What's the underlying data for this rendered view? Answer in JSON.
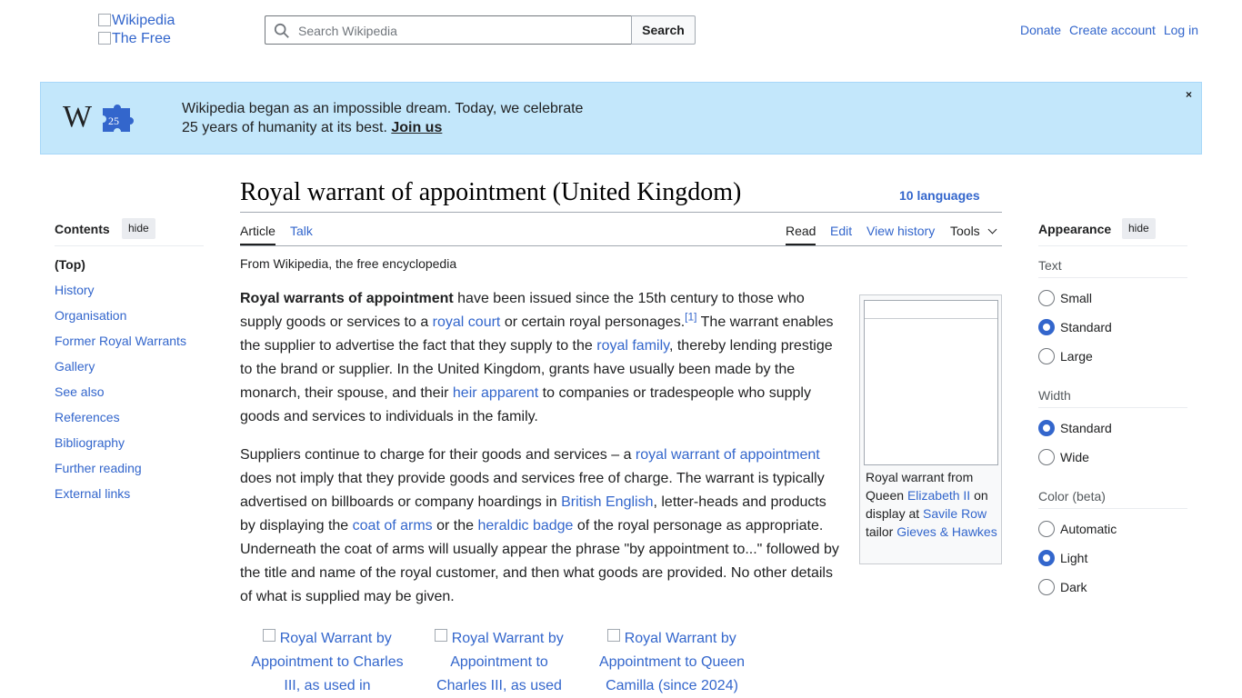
{
  "header": {
    "logo_alt": "Wikipedia",
    "logo_alt_2": "The Free",
    "search_placeholder": "Search Wikipedia",
    "search_button": "Search",
    "donate": "Donate",
    "create_account": "Create account",
    "log_in": "Log in"
  },
  "banner": {
    "line1": "Wikipedia began as an impossible dream. Today, we celebrate",
    "line2": "25 years of humanity at its best. ",
    "join": "Join us",
    "close": "×",
    "logo_badge": "25"
  },
  "page": {
    "title": "Royal warrant of appointment (United Kingdom)",
    "languages": "10 languages",
    "tabs": {
      "article": "Article",
      "talk": "Talk",
      "read": "Read",
      "edit": "Edit",
      "history": "View history",
      "tools": "Tools"
    },
    "from": "From Wikipedia, the free encyclopedia"
  },
  "toc": {
    "heading": "Contents",
    "hide": "hide",
    "items": [
      "(Top)",
      "History",
      "Organisation",
      "Former Royal Warrants",
      "Gallery",
      "See also",
      "References",
      "Bibliography",
      "Further reading",
      "External links"
    ]
  },
  "appearance": {
    "heading": "Appearance",
    "hide": "hide",
    "text_label": "Text",
    "text_options": [
      "Small",
      "Standard",
      "Large"
    ],
    "text_selected": "Standard",
    "width_label": "Width",
    "width_options": [
      "Standard",
      "Wide"
    ],
    "width_selected": "Standard",
    "color_label": "Color (beta)",
    "color_options": [
      "Automatic",
      "Light",
      "Dark"
    ],
    "color_selected": "Light"
  },
  "article": {
    "p1": {
      "bold": "Royal warrants of appointment",
      "t1": " have been issued since the 15th century to those who supply goods or services to a ",
      "l1": "royal court",
      "t2": " or certain royal personages.",
      "ref": "[1]",
      "t3": " The warrant enables the supplier to advertise the fact that they supply to the ",
      "l2": "royal family",
      "t4": ", thereby lending prestige to the brand or supplier. In the United Kingdom, grants have usually been made by the monarch, their spouse, and their ",
      "l3": "heir apparent",
      "t5": " to companies or tradespeople who supply goods and services to individuals in the family."
    },
    "p2": {
      "t1": "Suppliers continue to charge for their goods and services – a ",
      "l1": "royal warrant of appointment",
      "t2": " does not imply that they provide goods and services free of charge. The warrant is typically advertised on billboards or company hoardings in ",
      "l2": "British English",
      "t3": ", letter-heads and products by displaying the ",
      "l3": "coat of arms",
      "t4": " or the ",
      "l4": "heraldic badge",
      "t5": " of the royal personage as appropriate. Underneath the coat of arms will usually appear the phrase \"by appointment to...\" followed by the title and name of the royal customer, and then what goods are provided. No other details of what is supplied may be given."
    },
    "infobox": {
      "t1": "Royal warrant from Queen ",
      "l1": "Elizabeth II",
      "t2": " on display at ",
      "l2": "Savile Row",
      "t3": " tailor ",
      "l3": "Gieves & Hawkes"
    },
    "gallery": [
      "Royal Warrant by Appointment to Charles III, as used in",
      "Royal Warrant by Appointment to Charles III, as used",
      "Royal Warrant by Appointment to Queen Camilla (since 2024)"
    ]
  }
}
